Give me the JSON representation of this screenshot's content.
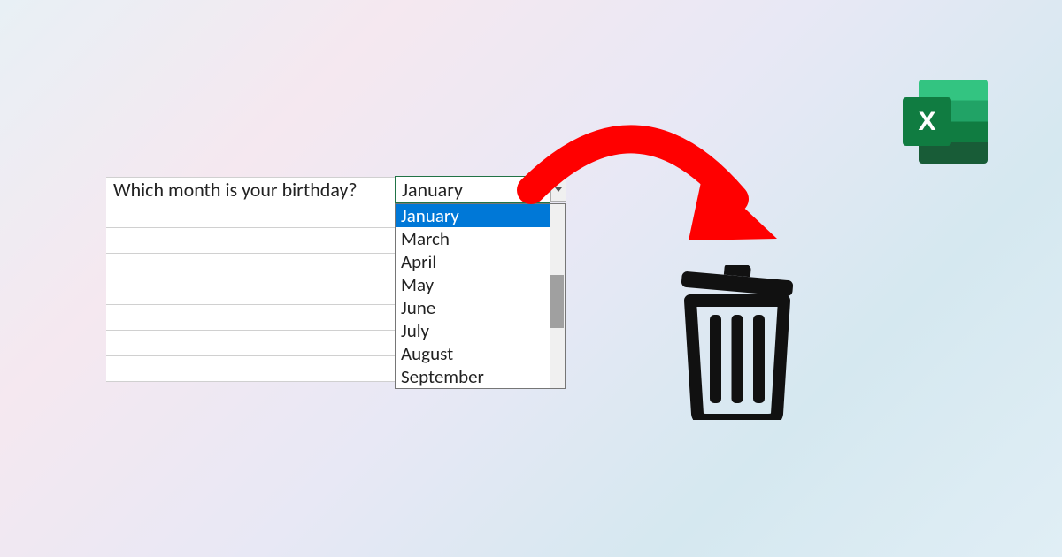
{
  "excel_logo_letter": "X",
  "question": "Which month is your birthday?",
  "selected_value": "January",
  "dropdown_options": [
    "January",
    "March",
    "April",
    "May",
    "June",
    "July",
    "August",
    "September"
  ],
  "highlighted_index": 0
}
